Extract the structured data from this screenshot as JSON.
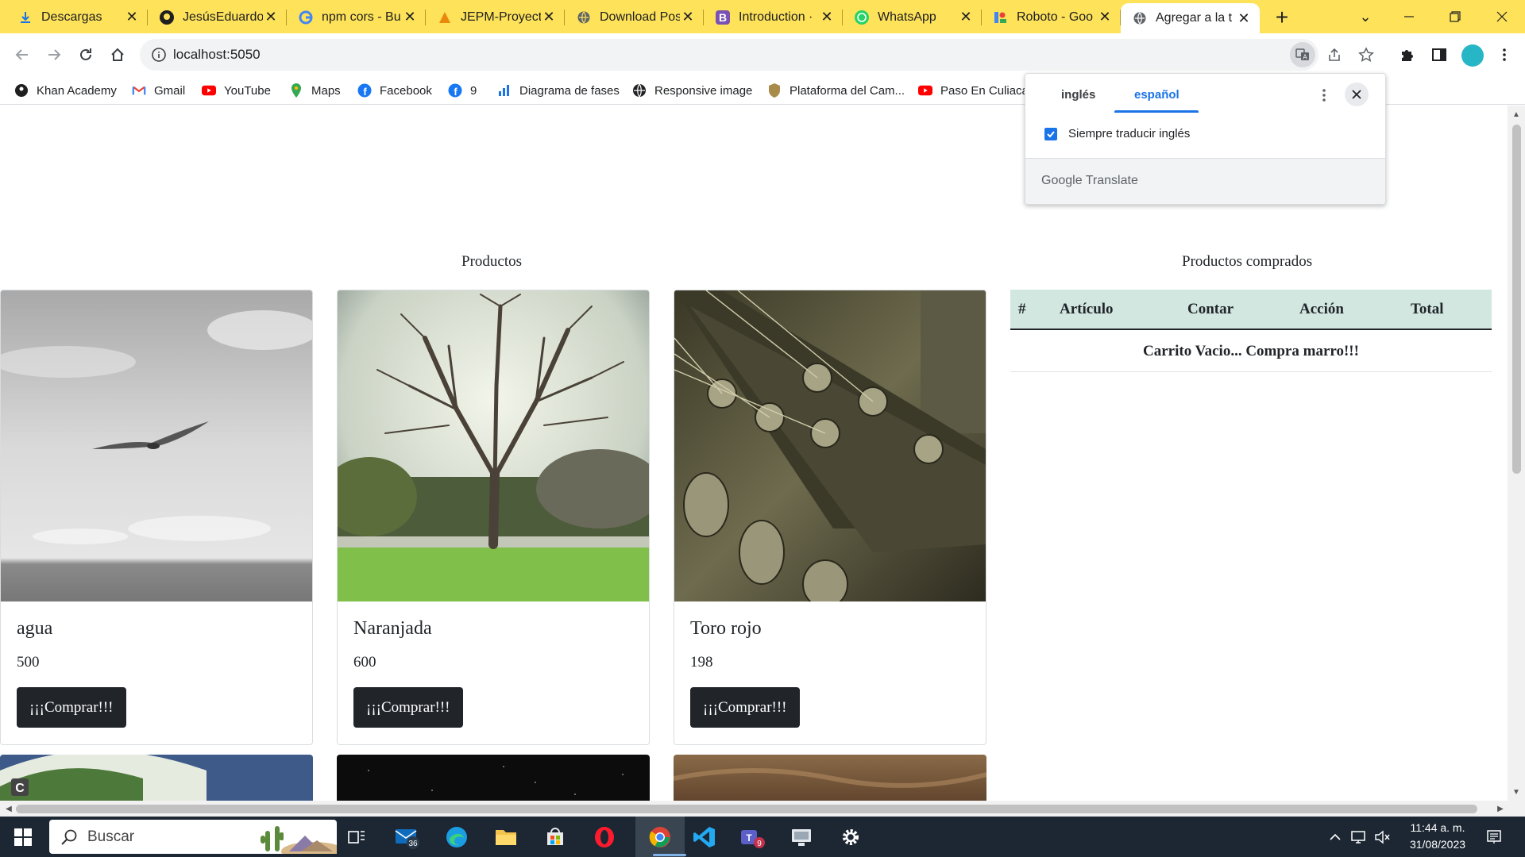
{
  "browser": {
    "tabs": [
      {
        "title": "Descargas",
        "icon": "download-icon"
      },
      {
        "title": "JesúsEduardo",
        "icon": "github-icon"
      },
      {
        "title": "npm cors - Bu",
        "icon": "google-icon"
      },
      {
        "title": "JEPM-Proyecto",
        "icon": "vercel-icon"
      },
      {
        "title": "Download Pos",
        "icon": "globe-icon"
      },
      {
        "title": "Introduction ·",
        "icon": "bootstrap-icon"
      },
      {
        "title": "WhatsApp",
        "icon": "whatsapp-icon"
      },
      {
        "title": "Roboto - Goo",
        "icon": "google-fonts-icon"
      },
      {
        "title": "Agregar a la t",
        "icon": "globe-icon"
      }
    ],
    "url": "localhost:5050",
    "bookmarks": [
      {
        "label": "Khan Academy",
        "icon": "khan-icon"
      },
      {
        "label": "Gmail",
        "icon": "gmail-icon"
      },
      {
        "label": "YouTube",
        "icon": "youtube-icon"
      },
      {
        "label": "Maps",
        "icon": "maps-icon"
      },
      {
        "label": "Facebook",
        "icon": "facebook-icon"
      },
      {
        "label": "9",
        "icon": "facebook-icon"
      },
      {
        "label": "Diagrama de fases",
        "icon": "chart-icon"
      },
      {
        "label": "Responsive image",
        "icon": "globe-icon"
      },
      {
        "label": "Plataforma del Cam...",
        "icon": "seal-icon"
      },
      {
        "label": "Paso En Culiacan",
        "icon": "youtube-icon"
      }
    ]
  },
  "translate_popup": {
    "source_lang": "inglés",
    "target_lang": "español",
    "always_translate_label": "Siempre traducir inglés",
    "always_translate_checked": true,
    "brand_google": "Google",
    "brand_translate": "Translate"
  },
  "page": {
    "products_title": "Productos",
    "products": [
      {
        "name": "agua",
        "price": "500",
        "button": "¡¡¡Comprar!!!",
        "image": "bird over sea photo"
      },
      {
        "name": "Naranjada",
        "price": "600",
        "button": "¡¡¡Comprar!!!",
        "image": "tree in park photo"
      },
      {
        "name": "Toro rojo",
        "price": "198",
        "button": "¡¡¡Comprar!!!",
        "image": "guitar headstock photo"
      }
    ],
    "cart_title": "Productos comprados",
    "cart_headers": [
      "#",
      "Artículo",
      "Contar",
      "Acción",
      "Total"
    ],
    "cart_empty_message": "Carrito Vacio... Compra marro!!!"
  },
  "taskbar": {
    "search_placeholder": "Buscar",
    "mail_badge": "36",
    "teams_badge": "9",
    "time": "11:44 a. m.",
    "date": "31/08/2023"
  }
}
